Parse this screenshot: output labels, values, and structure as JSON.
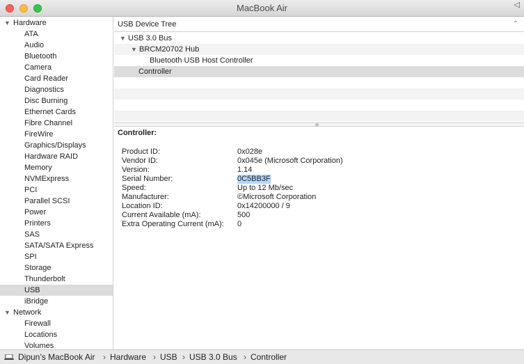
{
  "window": {
    "title": "MacBook Air",
    "top_right_glyph": "◁"
  },
  "sidebar": {
    "rows": [
      {
        "type": "category",
        "label": "Hardware"
      },
      {
        "type": "item",
        "label": "ATA"
      },
      {
        "type": "item",
        "label": "Audio"
      },
      {
        "type": "item",
        "label": "Bluetooth"
      },
      {
        "type": "item",
        "label": "Camera"
      },
      {
        "type": "item",
        "label": "Card Reader"
      },
      {
        "type": "item",
        "label": "Diagnostics"
      },
      {
        "type": "item",
        "label": "Disc Burning"
      },
      {
        "type": "item",
        "label": "Ethernet Cards"
      },
      {
        "type": "item",
        "label": "Fibre Channel"
      },
      {
        "type": "item",
        "label": "FireWire"
      },
      {
        "type": "item",
        "label": "Graphics/Displays"
      },
      {
        "type": "item",
        "label": "Hardware RAID"
      },
      {
        "type": "item",
        "label": "Memory"
      },
      {
        "type": "item",
        "label": "NVMExpress"
      },
      {
        "type": "item",
        "label": "PCI"
      },
      {
        "type": "item",
        "label": "Parallel SCSI"
      },
      {
        "type": "item",
        "label": "Power"
      },
      {
        "type": "item",
        "label": "Printers"
      },
      {
        "type": "item",
        "label": "SAS"
      },
      {
        "type": "item",
        "label": "SATA/SATA Express"
      },
      {
        "type": "item",
        "label": "SPI"
      },
      {
        "type": "item",
        "label": "Storage"
      },
      {
        "type": "item",
        "label": "Thunderbolt"
      },
      {
        "type": "item",
        "label": "USB",
        "selected": true
      },
      {
        "type": "item",
        "label": "iBridge"
      },
      {
        "type": "category",
        "label": "Network"
      },
      {
        "type": "item",
        "label": "Firewall"
      },
      {
        "type": "item",
        "label": "Locations"
      },
      {
        "type": "item",
        "label": "Volumes"
      }
    ]
  },
  "tree": {
    "header": "USB Device Tree",
    "rows": [
      {
        "label": "USB 3.0 Bus",
        "expanded": true,
        "level": 0
      },
      {
        "label": "BRCM20702 Hub",
        "expanded": true,
        "level": 1
      },
      {
        "label": "Bluetooth USB Host Controller",
        "level": 3
      },
      {
        "label": "Controller",
        "level": 2,
        "selected": true
      }
    ]
  },
  "details": {
    "title": "Controller:",
    "rows": [
      {
        "key": "Product ID:",
        "value": "0x028e"
      },
      {
        "key": "Vendor ID:",
        "value": "0x045e  (Microsoft Corporation)"
      },
      {
        "key": "Version:",
        "value": "1.14"
      },
      {
        "key": "Serial Number:",
        "value": "0C5BB3F",
        "highlight": true
      },
      {
        "key": "Speed:",
        "value": "Up to 12 Mb/sec"
      },
      {
        "key": "Manufacturer:",
        "value": "©Microsoft Corporation"
      },
      {
        "key": "Location ID:",
        "value": "0x14200000 / 9"
      },
      {
        "key": "Current Available (mA):",
        "value": "500"
      },
      {
        "key": "Extra Operating Current (mA):",
        "value": "0"
      }
    ]
  },
  "statusbar": {
    "breadcrumbs": [
      "Dipun’s MacBook Air",
      "Hardware",
      "USB",
      "USB 3.0 Bus",
      "Controller"
    ],
    "separator": "›",
    "icon": "laptop-icon"
  },
  "colors": {
    "selection_gray": "#dcdcdc",
    "text_highlight": "#b4d5fe",
    "close": "#fc605b",
    "minimize": "#fdbc40",
    "zoom": "#34c84a"
  }
}
